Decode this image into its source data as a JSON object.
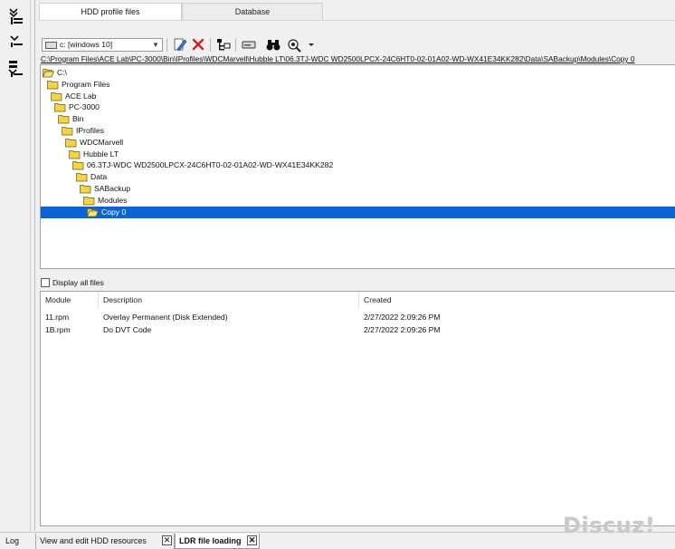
{
  "tabs": {
    "hdd_profile_files": "HDD profile files",
    "database": "Database"
  },
  "toolbar": {
    "drive": "c: [windows 10]",
    "icons": [
      "drive-icon",
      "edit-icon",
      "delete-icon",
      "tree-icon",
      "disk-icon",
      "binoculars-icon",
      "tools-icon",
      "dropdown-arrow-icon"
    ]
  },
  "path": "C:\\Program Files\\ACE Lab\\PC-3000\\Bin\\IProfiles\\WDCMarvell\\Hubble LT\\06.3TJ-WDC WD2500LPCX-24C6HT0-02-01A02-WD-WX41E34KK282\\Data\\SABackup\\Modules\\Copy 0",
  "tree": [
    {
      "label": "C:\\"
    },
    {
      "label": "Program Files"
    },
    {
      "label": "ACE Lab"
    },
    {
      "label": "PC-3000"
    },
    {
      "label": "Bin"
    },
    {
      "label": "IProfiles"
    },
    {
      "label": "WDCMarvell"
    },
    {
      "label": "Hubble LT"
    },
    {
      "label": "06.3TJ-WDC WD2500LPCX-24C6HT0-02-01A02-WD-WX41E34KK282"
    },
    {
      "label": "Data"
    },
    {
      "label": "SABackup"
    },
    {
      "label": "Modules"
    },
    {
      "label": "Copy 0",
      "selected": true
    }
  ],
  "display_all_files": {
    "label": "Display all files",
    "checked": false
  },
  "file_list": {
    "columns": [
      "Module",
      "Description",
      "Created"
    ],
    "rows": [
      [
        "11.rpm",
        "Overlay Permanent (Disk Extended)",
        "2/27/2022 2:09:26 PM"
      ],
      [
        "1B.rpm",
        "Do DVT Code",
        "2/27/2022 2:09:26 PM"
      ]
    ]
  },
  "bottom_tabs": {
    "log": "Log",
    "view_edit": "View and edit HDD resources",
    "ldr": "LDR file loading",
    "close_glyph": "✕"
  },
  "watermark": "Discuz!",
  "colors": {
    "selection": "#0a64d6",
    "folder": "#f2d34a",
    "delete": "#d11f1f"
  }
}
